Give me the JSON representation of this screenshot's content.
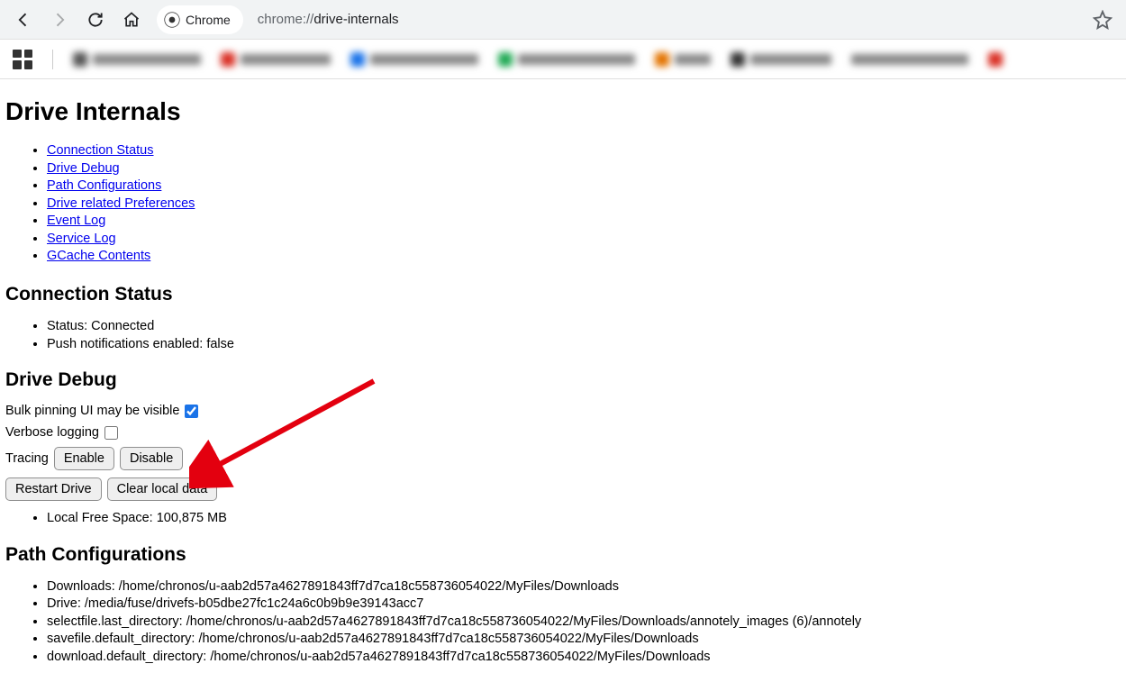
{
  "browser": {
    "chrome_label": "Chrome",
    "url_prefix": "chrome://",
    "url_main": "drive-internals"
  },
  "page": {
    "title": "Drive Internals",
    "toc": [
      "Connection Status",
      "Drive Debug",
      "Path Configurations",
      "Drive related Preferences",
      "Event Log",
      "Service Log",
      "GCache Contents"
    ],
    "connection": {
      "heading": "Connection Status",
      "status": "Status: Connected",
      "push": "Push notifications enabled: false"
    },
    "debug": {
      "heading": "Drive Debug",
      "bulk_pinning": "Bulk pinning UI may be visible",
      "verbose": "Verbose logging",
      "tracing": "Tracing",
      "enable": "Enable",
      "disable": "Disable",
      "restart": "Restart Drive",
      "clear": "Clear local data",
      "free_space": "Local Free Space: 100,875 MB"
    },
    "paths": {
      "heading": "Path Configurations",
      "items": [
        "Downloads: /home/chronos/u-aab2d57a4627891843ff7d7ca18c558736054022/MyFiles/Downloads",
        "Drive: /media/fuse/drivefs-b05dbe27fc1c24a6c0b9b9e39143acc7",
        "selectfile.last_directory: /home/chronos/u-aab2d57a4627891843ff7d7ca18c558736054022/MyFiles/Downloads/annotely_images (6)/annotely",
        "savefile.default_directory: /home/chronos/u-aab2d57a4627891843ff7d7ca18c558736054022/MyFiles/Downloads",
        "download.default_directory: /home/chronos/u-aab2d57a4627891843ff7d7ca18c558736054022/MyFiles/Downloads"
      ]
    }
  }
}
